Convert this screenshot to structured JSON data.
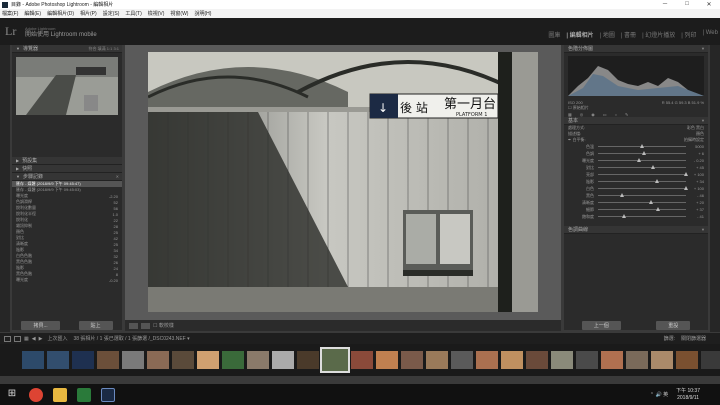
{
  "window": {
    "title": "目錄 - Adobe Photoshop Lightroom - 編輯相片",
    "min": "─",
    "max": "□",
    "close": "✕"
  },
  "menu": [
    "檔案(F)",
    "編輯(E)",
    "編輯相片(D)",
    "相片(P)",
    "設定(S)",
    "工具(T)",
    "檢視(V)",
    "視窗(W)",
    "說明(H)"
  ],
  "identity": {
    "logo": "Lr",
    "line1": "Adobe Lightroom",
    "line2": "開始使用 Lightroom mobile"
  },
  "modules": [
    "圖庫",
    "編輯相片",
    "地圖",
    "書冊",
    "幻燈片播放",
    "列印",
    "Web"
  ],
  "active_module_index": 1,
  "left": {
    "navigator": {
      "title": "導覽器",
      "fit": "符合",
      "fill": "填滿",
      "z1": "1:1",
      "z2": "3:1"
    },
    "presets": "預設集",
    "snapshots": "快照",
    "history": {
      "title": "步驟記錄",
      "rows": [
        {
          "label": "匯存 - 媒體 (2018/9/9 下午 09:45:47)",
          "a": "",
          "b": ""
        },
        {
          "label": "匯存 - 媒體 (2018/9/9 下午 09:45:03)",
          "a": "",
          "b": ""
        },
        {
          "label": "曝光度",
          "a": "-",
          "b": "-2.20"
        },
        {
          "label": "色調滑桿",
          "a": "",
          "b": "52"
        },
        {
          "label": "銳利化數量",
          "a": "",
          "b": "56"
        },
        {
          "label": "銳利化半徑",
          "a": "",
          "b": "1.0"
        },
        {
          "label": "銳利化",
          "a": "",
          "b": "22"
        },
        {
          "label": "雜訊抑制",
          "a": "",
          "b": "28"
        },
        {
          "label": "顏色",
          "a": "",
          "b": "25"
        },
        {
          "label": "對比",
          "a": "",
          "b": "42"
        },
        {
          "label": "清晰度",
          "a": "",
          "b": "25"
        },
        {
          "label": "陰影",
          "a": "",
          "b": "34"
        },
        {
          "label": "白色色階",
          "a": "",
          "b": "32"
        },
        {
          "label": "黑色色階",
          "a": "",
          "b": "26"
        },
        {
          "label": "陰影",
          "a": "",
          "b": "24"
        },
        {
          "label": "黑色色階",
          "a": "",
          "b": "8"
        },
        {
          "label": "曝光度",
          "a": "",
          "b": "-0.20"
        }
      ]
    },
    "copy_btn": "拷貝...",
    "paste_btn": "貼上"
  },
  "toolbar": {
    "softproof": "軟校樣"
  },
  "right": {
    "histogram": {
      "title": "色階分佈圖",
      "iso": "ISO 200",
      "stats": "R 55.4  G 59.3  B 51.9 %",
      "orig": "原始相片"
    },
    "basic": {
      "title": "基本",
      "treatment_label": "處理方式:",
      "color": "彩色",
      "bw": "黑白",
      "profile": "描述檔:",
      "profile_value": "顏色",
      "wb_label": "白平衡:",
      "wb_value": "拍攝時設定",
      "tone_label": "色調",
      "auto": "自動",
      "presence": "外觀"
    },
    "sliders": [
      {
        "label": "色溫",
        "value": "5000",
        "pos": 0.5
      },
      {
        "label": "色調",
        "value": "+ 6",
        "pos": 0.52
      },
      {
        "label": "曝光度",
        "value": "- 0.20",
        "pos": 0.47
      },
      {
        "label": "對比",
        "value": "+ 45",
        "pos": 0.62
      },
      {
        "label": "亮部",
        "value": "+ 100",
        "pos": 1.0
      },
      {
        "label": "陰影",
        "value": "+ 34",
        "pos": 0.67
      },
      {
        "label": "白色",
        "value": "+ 100",
        "pos": 1.0
      },
      {
        "label": "黑色",
        "value": "- 46",
        "pos": 0.27
      },
      {
        "label": "清晰度",
        "value": "+ 20",
        "pos": 0.6
      },
      {
        "label": "細節",
        "value": "+ 37",
        "pos": 0.68
      },
      {
        "label": "飽和度",
        "value": "- 41",
        "pos": 0.3
      }
    ],
    "tone_curve": "色調曲線",
    "prev_btn": "上一個",
    "reset_btn": "重設"
  },
  "filmbar": {
    "prev_import": "上次匯入",
    "info": "38 張相片 / 1 張已選取 / 1 張篩選 /_DSC0243.NEF ▾",
    "filter": "篩選:",
    "filter_value": "關閉篩選器"
  },
  "thumb_colors": [
    "#2d4a6a",
    "#324e6e",
    "#1e3050",
    "#6b4f3a",
    "#7a7a7a",
    "#8a6a55",
    "#5a4a3a",
    "#d0a070",
    "#3a6a3a",
    "#8a7a6a",
    "#aaa",
    "#4a3a2a",
    "#5a6a4a",
    "#8a4a3a",
    "#c08050",
    "#7a5a4a",
    "#9a7a5a",
    "#5a5a5a",
    "#aa7050",
    "#c09060",
    "#6a4a3a",
    "#8a8a7a",
    "#4a4a4a",
    "#b07050",
    "#7a6a5a",
    "#aa8a6a",
    "#7a5030",
    "#3a3a3a",
    "#c07060",
    "#6a5a4a"
  ],
  "selected_thumb": 12,
  "clock": {
    "time": "下午 10:37",
    "date": "2018/9/11"
  },
  "sys": "⌃ 🔊 英",
  "sign": {
    "back": "後 站",
    "cn": "第一月台",
    "en": "PLATFORM 1"
  }
}
